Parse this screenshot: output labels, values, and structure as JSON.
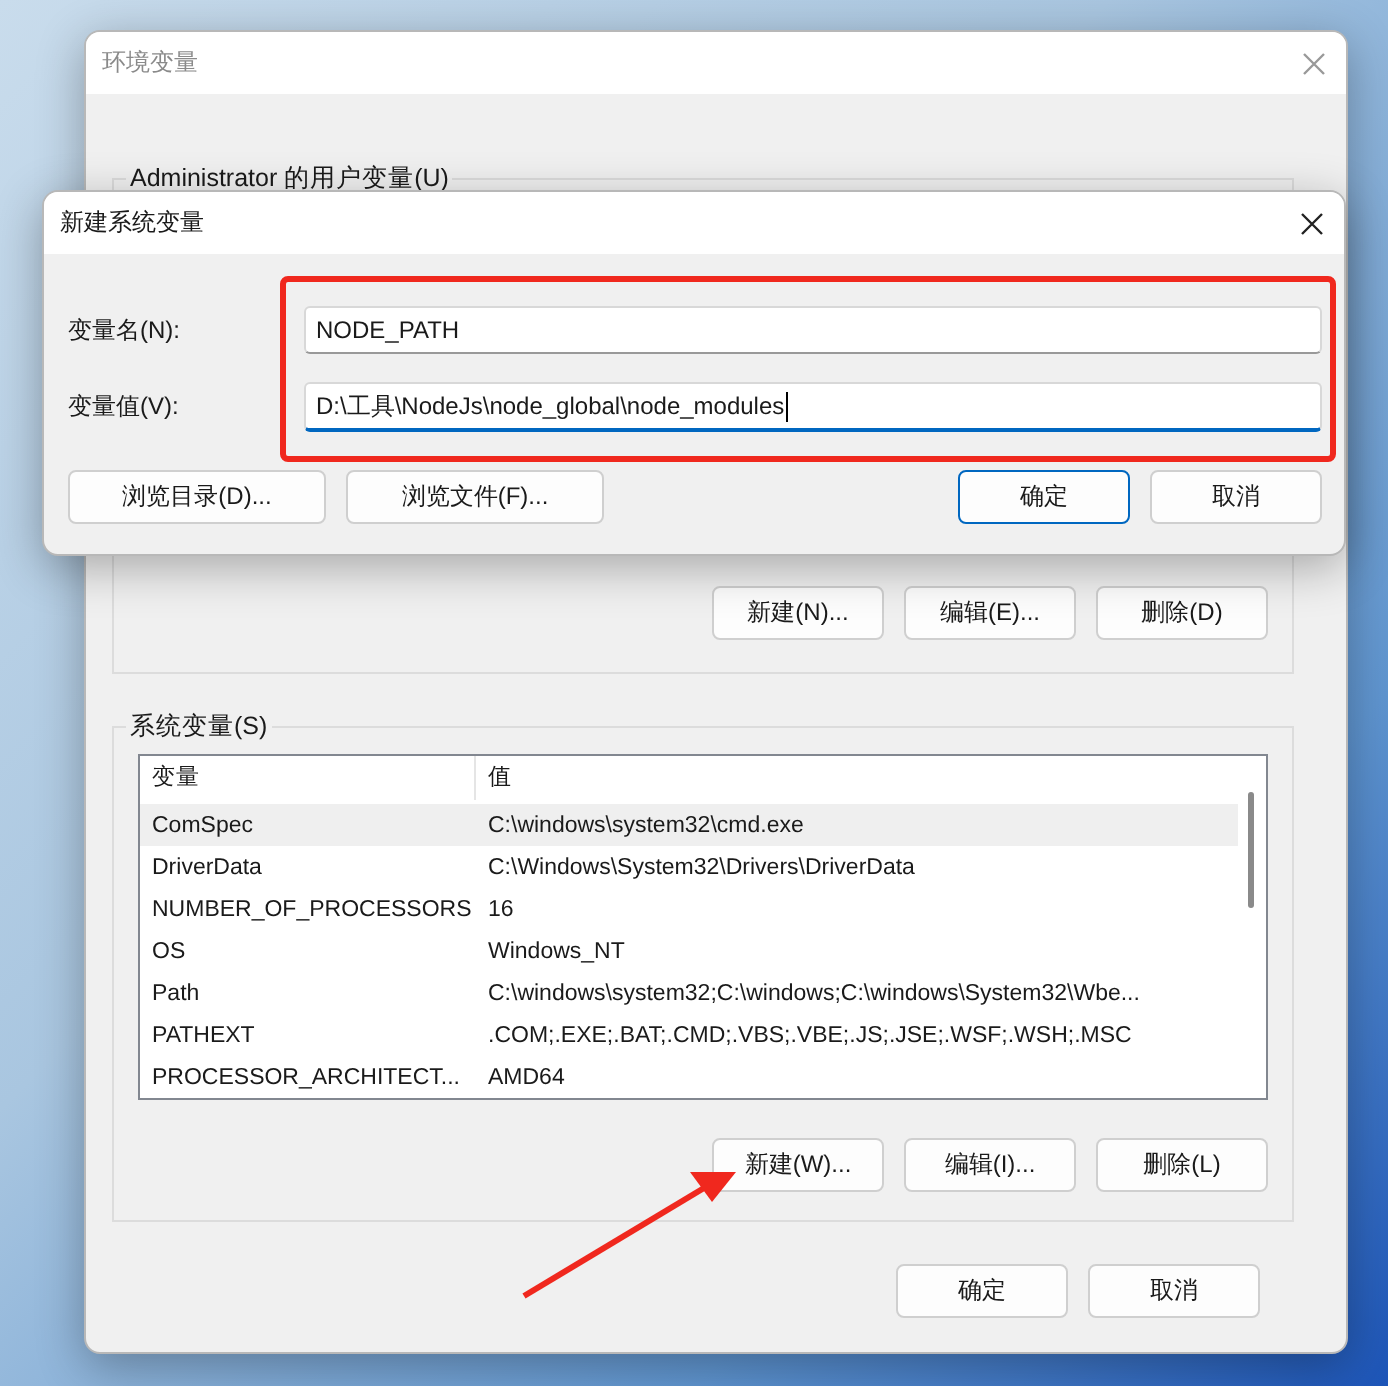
{
  "main_window": {
    "title": "环境变量",
    "user_variables": {
      "label": "Administrator 的用户变量(U)",
      "buttons": [
        "新建(N)...",
        "编辑(E)...",
        "删除(D)"
      ]
    },
    "system_variables": {
      "label": "系统变量(S)",
      "columns": [
        "变量",
        "值"
      ],
      "rows": [
        {
          "name": "ComSpec",
          "value": "C:\\windows\\system32\\cmd.exe",
          "selected": true
        },
        {
          "name": "DriverData",
          "value": "C:\\Windows\\System32\\Drivers\\DriverData",
          "selected": false
        },
        {
          "name": "NUMBER_OF_PROCESSORS",
          "value": "16",
          "selected": false
        },
        {
          "name": "OS",
          "value": "Windows_NT",
          "selected": false
        },
        {
          "name": "Path",
          "value": "C:\\windows\\system32;C:\\windows;C:\\windows\\System32\\Wbe...",
          "selected": false
        },
        {
          "name": "PATHEXT",
          "value": ".COM;.EXE;.BAT;.CMD;.VBS;.VBE;.JS;.JSE;.WSF;.WSH;.MSC",
          "selected": false
        },
        {
          "name": "PROCESSOR_ARCHITECT...",
          "value": "AMD64",
          "selected": false
        }
      ],
      "buttons": [
        "新建(W)...",
        "编辑(I)...",
        "删除(L)"
      ]
    },
    "buttons": [
      "确定",
      "取消"
    ]
  },
  "dialog": {
    "title": "新建系统变量",
    "fields": [
      {
        "label": "变量名(N):",
        "value": "NODE_PATH",
        "focused": false
      },
      {
        "label": "变量值(V):",
        "value": "D:\\工具\\NodeJs\\node_global\\node_modules",
        "focused": true
      }
    ],
    "buttons": [
      {
        "label": "浏览目录(D)...",
        "default": false
      },
      {
        "label": "浏览文件(F)...",
        "default": false
      },
      {
        "label": "确定",
        "default": true
      },
      {
        "label": "取消",
        "default": false
      }
    ]
  }
}
